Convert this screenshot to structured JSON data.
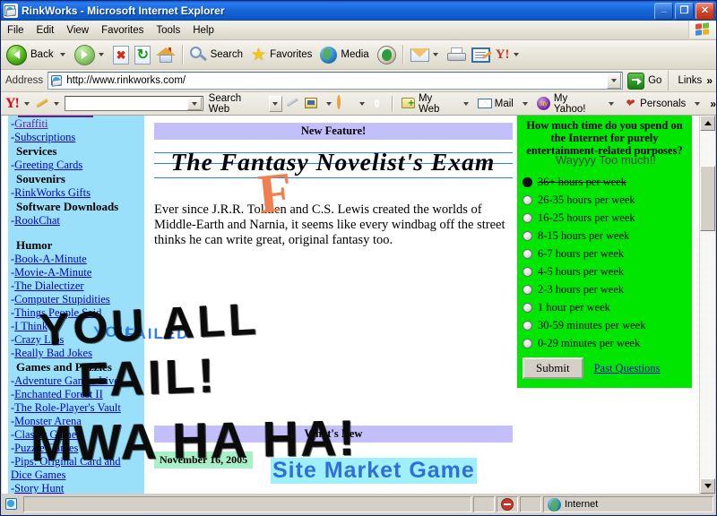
{
  "window": {
    "title": "RinkWorks - Microsoft Internet Explorer",
    "minimize": "_",
    "maximize": "❐",
    "close": "✕"
  },
  "menu": {
    "items": [
      "File",
      "Edit",
      "View",
      "Favorites",
      "Tools",
      "Help"
    ]
  },
  "toolbar": {
    "back": "Back",
    "search": "Search",
    "favorites": "Favorites",
    "media": "Media"
  },
  "address": {
    "label": "Address",
    "url": "http://www.rinkworks.com/",
    "go": "Go",
    "links": "Links",
    "chevron": "»"
  },
  "yahoo_toolbar": {
    "logo": "Y!",
    "search_value": "",
    "search_web": "Search Web",
    "my_web": "My Web",
    "mail": "Mail",
    "my_yahoo": "My Yahoo!",
    "personals": "Personals",
    "overflow": "»"
  },
  "sidebar": {
    "items": [
      {
        "label": "Graffiti",
        "type": "link",
        "visited": true
      },
      {
        "label": "Subscriptions",
        "type": "link",
        "visited": false
      },
      {
        "label": "Services",
        "type": "heading"
      },
      {
        "label": "Greeting Cards",
        "type": "link",
        "visited": false
      },
      {
        "label": "Souvenirs",
        "type": "heading"
      },
      {
        "label": "RinkWorks Gifts",
        "type": "link",
        "visited": false
      },
      {
        "label": "Software Downloads",
        "type": "heading"
      },
      {
        "label": "RookChat",
        "type": "link",
        "visited": false
      },
      {
        "label": "",
        "type": "spacer"
      },
      {
        "label": "Humor",
        "type": "heading"
      },
      {
        "label": "Book-A-Minute",
        "type": "link",
        "visited": false
      },
      {
        "label": "Movie-A-Minute",
        "type": "link",
        "visited": false
      },
      {
        "label": "The Dialectizer",
        "type": "link",
        "visited": false
      },
      {
        "label": "Computer Stupidities",
        "type": "link",
        "visited": false
      },
      {
        "label": "Things People Said",
        "type": "link",
        "visited": false
      },
      {
        "label": "I Think",
        "type": "link",
        "visited": false
      },
      {
        "label": "Crazy Libs",
        "type": "link",
        "visited": false
      },
      {
        "label": "Really Bad Jokes",
        "type": "link",
        "visited": false
      },
      {
        "label": "Games and Puzzles",
        "type": "heading"
      },
      {
        "label": "Adventure Games Live",
        "type": "link",
        "visited": false
      },
      {
        "label": "Enchanted Forest II",
        "type": "link",
        "visited": false
      },
      {
        "label": "The Role-Player's Vault",
        "type": "link",
        "visited": false
      },
      {
        "label": "Monster Arena",
        "type": "link",
        "visited": false
      },
      {
        "label": "Classic Games",
        "type": "link",
        "visited": false
      },
      {
        "label": "Puzzle Games",
        "type": "link",
        "visited": false
      },
      {
        "label": "Pips: Original Card and Dice Games",
        "type": "link",
        "visited": false
      },
      {
        "label": "Story Hunt",
        "type": "link",
        "visited": false
      }
    ],
    "bullet": "-"
  },
  "main": {
    "new_feature_banner": "New Feature!",
    "exam_title": "The Fantasy Novelist's Exam",
    "body": "Ever since J.R.R. Tolkien and C.S. Lewis created the worlds of Middle-Earth and Narnia, it seems like every windbag off the street thinks he can write great, original fantasy too.",
    "whats_new_banner": "What's New",
    "date": "November 16, 2005",
    "whats_new_title": "Site Market Game"
  },
  "poll": {
    "question": "How much time do you spend on the Internet for purely entertainment-related purposes?",
    "options": [
      {
        "label": "36+ hours per week",
        "selected": true,
        "struck": true
      },
      {
        "label": "26-35 hours per week",
        "selected": false,
        "struck": false
      },
      {
        "label": "16-25 hours per week",
        "selected": false,
        "struck": false
      },
      {
        "label": "8-15 hours per week",
        "selected": false,
        "struck": false
      },
      {
        "label": "6-7 hours per week",
        "selected": false,
        "struck": false
      },
      {
        "label": "4-5 hours per week",
        "selected": false,
        "struck": false
      },
      {
        "label": "2-3 hours per week",
        "selected": false,
        "struck": false
      },
      {
        "label": "1 hour per week",
        "selected": false,
        "struck": false
      },
      {
        "label": "30-59 minutes per week",
        "selected": false,
        "struck": false
      },
      {
        "label": "0-29 minutes per week",
        "selected": false,
        "struck": false
      }
    ],
    "submit": "Submit",
    "past_questions": "Past Questions"
  },
  "graffiti": {
    "poll_note": "Wayyyy Too much!!",
    "big_line1": "YOU ALL",
    "big_line2": "FAIL!",
    "laugh": "MWA HA HA!",
    "f_mark": "F",
    "sidebar_note_1": "YOU",
    "sidebar_note_2": "FAILED"
  },
  "status": {
    "message": "",
    "zone": "Internet"
  },
  "colors": {
    "sidebar_bg": "#9AE0FB",
    "poll_bg": "#00E600",
    "banner_bg": "#C3BFFA",
    "date_bg": "#A8F0C8",
    "link": "#0000CC",
    "visited_link": "#6A1B9A",
    "graffiti_orange": "#F08050",
    "graffiti_blue": "#2F80ED",
    "titlebar": "#1667DA"
  }
}
